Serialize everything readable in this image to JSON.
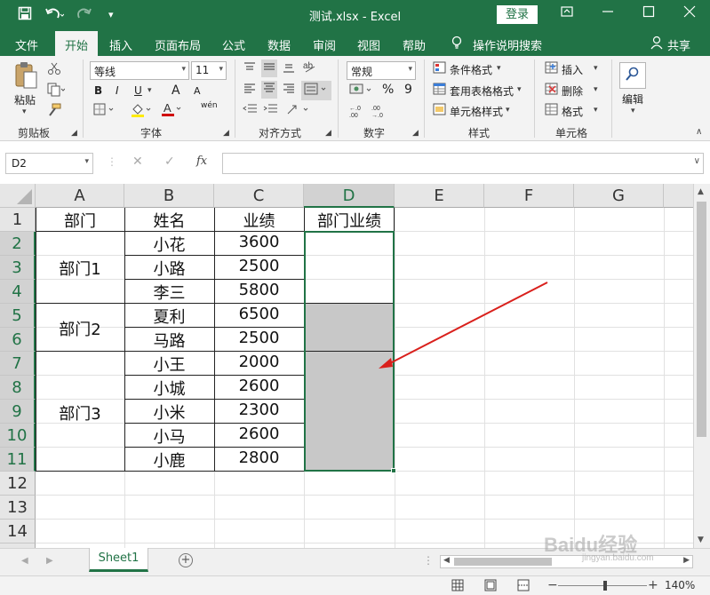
{
  "window": {
    "title": "测试.xlsx  -  Excel",
    "login_label": "登录",
    "qa_save_icon": "save-icon",
    "qa_undo_icon": "undo-icon",
    "qa_redo_icon": "redo-icon"
  },
  "tabs": [
    {
      "label": "文件"
    },
    {
      "label": "开始"
    },
    {
      "label": "插入"
    },
    {
      "label": "页面布局"
    },
    {
      "label": "公式"
    },
    {
      "label": "数据"
    },
    {
      "label": "审阅"
    },
    {
      "label": "视图"
    },
    {
      "label": "帮助"
    }
  ],
  "tell_me": "操作说明搜索",
  "share": "共享",
  "ribbon": {
    "clipboard": {
      "paste": "粘贴",
      "label": "剪贴板"
    },
    "font": {
      "name": "等线",
      "size": "11",
      "bold": "B",
      "italic": "I",
      "underline": "U",
      "grow": "A",
      "shrink": "A",
      "label": "字体",
      "wen": "wén"
    },
    "alignment": {
      "label": "对齐方式"
    },
    "number": {
      "format": "常规",
      "percent": "%",
      "comma": "9",
      "label": "数字"
    },
    "styles": {
      "cond": "条件格式",
      "table": "套用表格格式",
      "cell": "单元格样式",
      "label": "样式"
    },
    "cells": {
      "insert": "插入",
      "delete": "删除",
      "format": "格式",
      "label": "单元格"
    },
    "editing": {
      "label": "编辑"
    }
  },
  "formula_bar": {
    "name_box": "D2",
    "fx": "fx",
    "cancel": "✕",
    "enter": "✓",
    "formula": ""
  },
  "sheet": {
    "columns": [
      "A",
      "B",
      "C",
      "D",
      "E",
      "F",
      "G"
    ],
    "rows": [
      "1",
      "2",
      "3",
      "4",
      "5",
      "6",
      "7",
      "8",
      "9",
      "10",
      "11",
      "12",
      "13",
      "14"
    ],
    "headers": {
      "a": "部门",
      "b": "姓名",
      "c": "业绩",
      "d": "部门业绩"
    },
    "departments": [
      "部门1",
      "部门2",
      "部门3"
    ],
    "names": [
      "小花",
      "小路",
      "李三",
      "夏利",
      "马路",
      "小王",
      "小城",
      "小米",
      "小马",
      "小鹿"
    ],
    "scores": [
      "3600",
      "2500",
      "5800",
      "6500",
      "2500",
      "2000",
      "2600",
      "2300",
      "2600",
      "2800"
    ]
  },
  "sheet_tabs": {
    "active": "Sheet1"
  },
  "status": {
    "zoom": "140%"
  },
  "watermark": {
    "text": "Baidu经验",
    "sub": "jingyan.baidu.com"
  },
  "colors": {
    "excel_green": "#217346",
    "selection_grey": "#c8c8c8",
    "arrow_red": "#d9201c"
  }
}
